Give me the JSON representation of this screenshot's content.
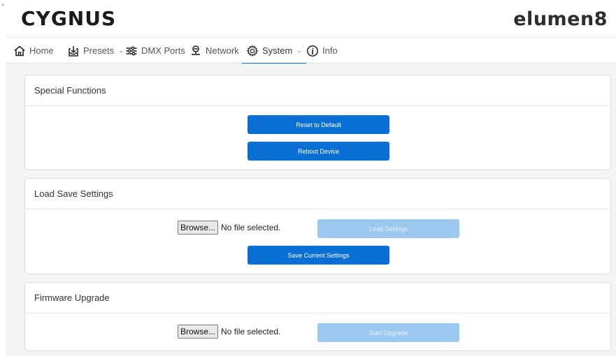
{
  "header": {
    "brand_left": "CYGNUS",
    "brand_right": "elumen8"
  },
  "nav": {
    "items": [
      {
        "label": "Home",
        "icon": "home-icon"
      },
      {
        "label": "Presets",
        "icon": "download-tray-icon",
        "caret": "⌄"
      },
      {
        "label": "DMX Ports",
        "icon": "sliders-icon"
      },
      {
        "label": "Network",
        "icon": "network-icon"
      },
      {
        "label": "System",
        "icon": "gear-icon",
        "caret": "⌄",
        "active": true
      },
      {
        "label": "Info",
        "icon": "info-icon"
      }
    ]
  },
  "special_functions": {
    "title": "Special Functions",
    "reset_label": "Reset to Default",
    "reboot_label": "Reboot Device"
  },
  "load_save": {
    "title": "Load Save Settings",
    "browse_label": "Browse...",
    "file_status": "No file selected.",
    "load_label": "Load Settings",
    "save_label": "Save Current Settings"
  },
  "firmware": {
    "title": "Firmware Upgrade",
    "browse_label": "Browse...",
    "file_status": "No file selected.",
    "upgrade_label": "Start Upgrade"
  },
  "colors": {
    "accent": "#0a6fd4",
    "disabled_button": "#9cc7ef",
    "content_background": "#f4f4f4"
  }
}
